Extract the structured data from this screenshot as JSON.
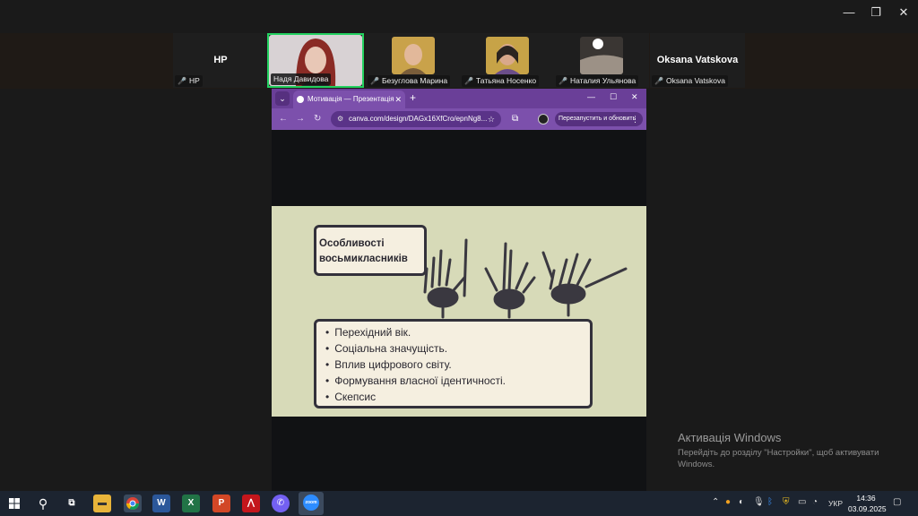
{
  "window_controls": {
    "minimize": "—",
    "restore": "❐",
    "close": "✕"
  },
  "participants": [
    {
      "name": "HP",
      "display_label": "HP",
      "mic": "muted"
    },
    {
      "name": "Надя Давидова",
      "mic": "on",
      "active": true
    },
    {
      "name": "Безуглова Марина",
      "mic": "muted"
    },
    {
      "name": "Татьяна Носенко",
      "mic": "muted"
    },
    {
      "name": "Наталия Ульянова",
      "mic": "muted"
    },
    {
      "name": "Oksana Vatskova",
      "display_label": "Oksana Vatskova",
      "mic": "muted"
    }
  ],
  "browser": {
    "tab_title": "Мотивація — Презентація",
    "url": "canva.com/design/DAGx16XfCro/epnNg8...",
    "restart_label": "Перезапустить и обновить"
  },
  "slide": {
    "title_line1": "Особливості",
    "title_line2": "восьмикласників",
    "bullets": [
      "Перехідний вік.",
      "Соціальна значущість.",
      "Вплив цифрового світу.",
      "Формування власної ідентичності.",
      "Скепсис"
    ]
  },
  "activation": {
    "title": "Активація Windows",
    "subtitle": "Перейдіть до розділу \"Настройки\", щоб активувати Windows."
  },
  "taskbar": {
    "language": "УКР",
    "time": "14:36",
    "date": "03.09.2025"
  },
  "colors": {
    "active_border": "#23d160",
    "chrome_purple": "#7c50ac",
    "slide_bg": "#d7dab8"
  }
}
